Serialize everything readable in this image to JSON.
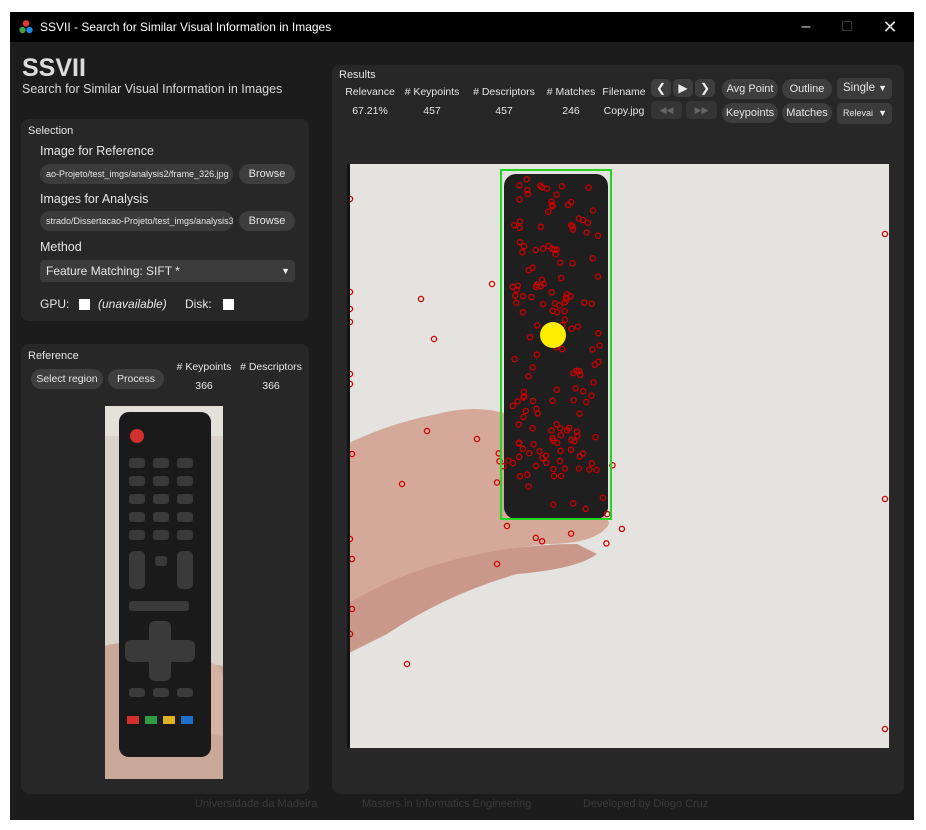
{
  "window": {
    "title": "SSVII - Search for Similar Visual Information in Images"
  },
  "app": {
    "title": "SSVII",
    "subtitle": "Search for Similar Visual Information in Images"
  },
  "selection": {
    "label": "Selection",
    "reference_label": "Image for Reference",
    "reference_path": "ao-Projeto/test_imgs/analysis2/frame_326.jpg",
    "analysis_label": "Images for Analysis",
    "analysis_path": "strado/Dissertacao-Projeto/test_imgs/analysis3",
    "browse_label": "Browse",
    "method_label": "Method",
    "method_value": "Feature Matching:  SIFT *",
    "gpu_label": "GPU:",
    "gpu_status": "(unavailable)",
    "disk_label": "Disk:"
  },
  "reference": {
    "label": "Reference",
    "select_region": "Select region",
    "process": "Process",
    "keypoints_header": "# Keypoints",
    "descriptors_header": "# Descriptors",
    "keypoints": "366",
    "descriptors": "366"
  },
  "results": {
    "label": "Results",
    "headers": {
      "relevance": "Relevance",
      "keypoints": "# Keypoints",
      "descriptors": "# Descriptors",
      "matches": "# Matches",
      "filename": "Filename"
    },
    "values": {
      "relevance": "67.21%",
      "keypoints": "457",
      "descriptors": "457",
      "matches": "246",
      "filename": "Copy.jpg"
    },
    "buttons": {
      "avg_point": "Avg Point",
      "outline": "Outline",
      "keypoints": "Keypoints",
      "matches": "Matches"
    },
    "view_mode": "Single",
    "sort_by": "Relevai"
  },
  "footer": {
    "university": "Universidade da Madeira",
    "course": "Masters in Informatics Engineering",
    "developer": "Developed by Diogo Cruz"
  },
  "colors": {
    "window_bg": "#1c1c1c",
    "panel_bg": "#272727",
    "outline_box": "#22d622",
    "keypoint": "#cc0000",
    "avg_point": "#ffee00"
  }
}
